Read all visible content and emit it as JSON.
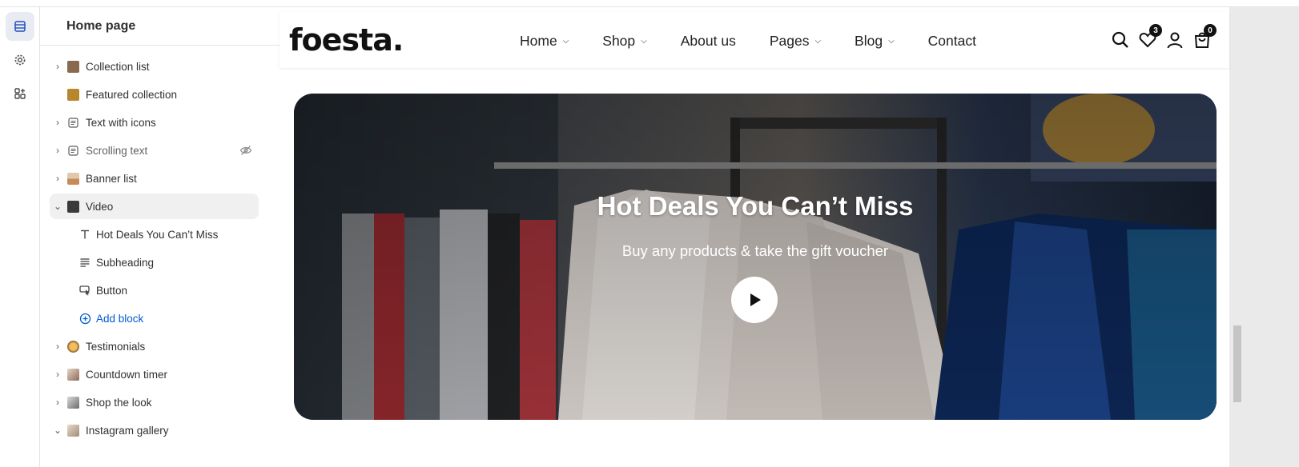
{
  "sidebar": {
    "title": "Home page",
    "items": [
      {
        "label": "Collection list",
        "thumb_color": "#8a6a4e"
      },
      {
        "label": "Featured collection",
        "thumb_color": "#b8862c"
      },
      {
        "label": "Text with icons",
        "thumb_color": "#5c5c5c"
      },
      {
        "label": "Scrolling text",
        "thumb_color": "#5c5c5c"
      },
      {
        "label": "Banner list",
        "thumb_color": "#c98a5a"
      },
      {
        "label": "Video",
        "thumb_color": "#3a3a3a"
      },
      {
        "label": "Testimonials",
        "thumb_color": "#d19a2a"
      },
      {
        "label": "Countdown timer",
        "thumb_color": "#8c6a58"
      },
      {
        "label": "Shop the look",
        "thumb_color": "#6b6b6b"
      },
      {
        "label": "Instagram gallery",
        "thumb_color": "#a08c7a"
      }
    ],
    "video_blocks": [
      {
        "label": "Hot Deals You Can’t Miss",
        "icon": "text-icon"
      },
      {
        "label": "Subheading",
        "icon": "paragraph-icon"
      },
      {
        "label": "Button",
        "icon": "button-icon"
      }
    ],
    "add_block": "Add block"
  },
  "store": {
    "logo": "foesta.",
    "menu": [
      {
        "label": "Home",
        "dropdown": true
      },
      {
        "label": "Shop",
        "dropdown": true
      },
      {
        "label": "About us",
        "dropdown": false
      },
      {
        "label": "Pages",
        "dropdown": true
      },
      {
        "label": "Blog",
        "dropdown": true
      },
      {
        "label": "Contact",
        "dropdown": false
      }
    ],
    "wishlist_count": "3",
    "cart_count": "0"
  },
  "video": {
    "heading": "Hot Deals You Can’t Miss",
    "subheading": "Buy any products & take the gift voucher"
  },
  "colors": {
    "accent": "#005bd3",
    "selected_row": "#f0f0f0",
    "rail_active": "#e8ebf2"
  }
}
